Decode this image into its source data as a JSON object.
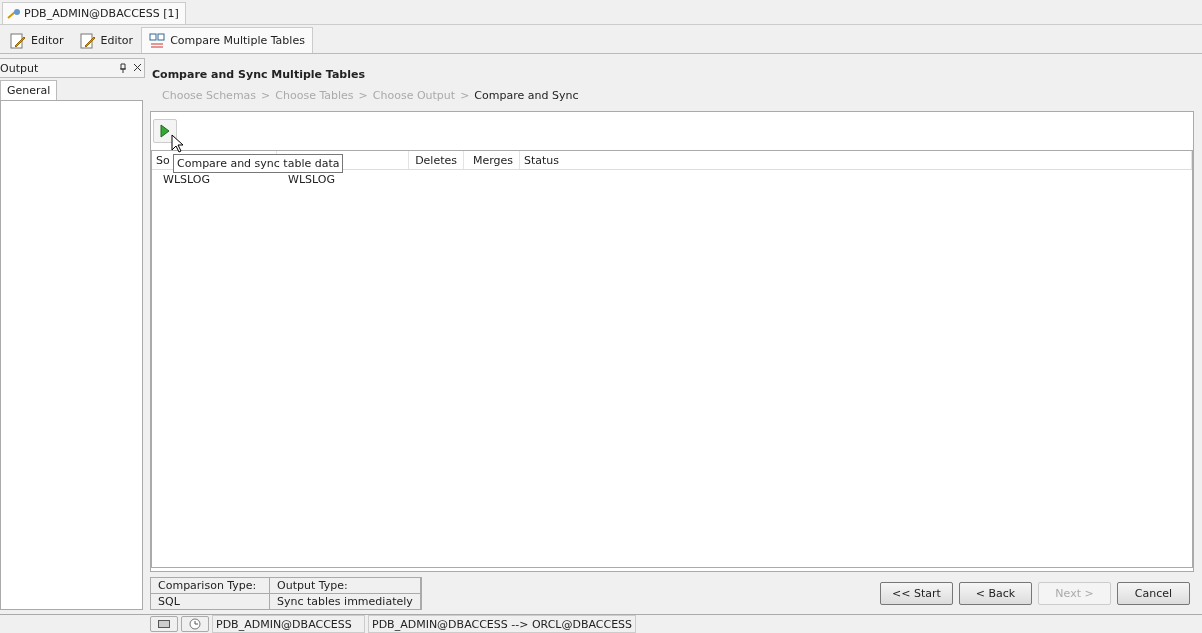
{
  "document_tab": {
    "title": "PDB_ADMIN@DBACCESS [1]"
  },
  "editor_tabs": [
    {
      "label": "Editor",
      "kind": "editor",
      "selected": false
    },
    {
      "label": "Editor",
      "kind": "editor",
      "selected": false
    },
    {
      "label": "Compare Multiple Tables",
      "kind": "compare",
      "selected": true
    }
  ],
  "output_panel": {
    "title": "Output",
    "tabs": [
      {
        "label": "General",
        "selected": true
      }
    ]
  },
  "wizard": {
    "title": "Compare and Sync Multiple Tables",
    "steps": [
      {
        "label": "Choose Schemas",
        "selected": false
      },
      {
        "label": "Choose Tables",
        "selected": false
      },
      {
        "label": "Choose Output",
        "selected": false
      },
      {
        "label": "Compare and Sync",
        "selected": true
      }
    ],
    "step_separator": ">",
    "tooltip": "Compare and sync table data",
    "table": {
      "columns": [
        "So",
        "",
        "Deletes",
        "Merges",
        "Status"
      ],
      "rows": [
        [
          "WLSLOG",
          "WLSLOG",
          "",
          "",
          ""
        ]
      ]
    },
    "summary": {
      "headers": [
        "Comparison Type:",
        "Output Type:"
      ],
      "values": [
        "SQL",
        "Sync tables immediately"
      ]
    },
    "buttons": [
      {
        "label": "<< Start",
        "disabled": false
      },
      {
        "label": "< Back",
        "disabled": false
      },
      {
        "label": "Next >",
        "disabled": true
      },
      {
        "label": "Cancel",
        "disabled": false
      }
    ]
  },
  "status_bar": {
    "fields": [
      "PDB_ADMIN@DBACCESS",
      "PDB_ADMIN@DBACCESS --> ORCL@DBACCESS"
    ]
  }
}
